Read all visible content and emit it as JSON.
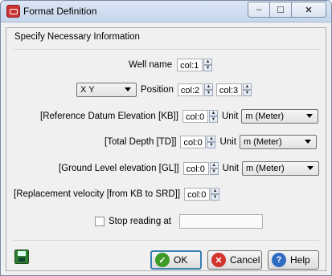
{
  "window": {
    "title": "Format Definition"
  },
  "titlebar": {
    "minimize": "–",
    "maximize": "☐",
    "close": "✕"
  },
  "header": "Specify Necessary Information",
  "well_name": {
    "label": "Well name",
    "value": "col:1"
  },
  "position": {
    "mode": "X Y",
    "label": "Position",
    "x_value": "col:2",
    "y_value": "col:3"
  },
  "ref_datum": {
    "label": "[Reference Datum Elevation [KB]]",
    "value": "col:0",
    "unit_label": "Unit",
    "unit": "m (Meter)"
  },
  "total_depth": {
    "label": "[Total Depth [TD]]",
    "value": "col:0",
    "unit_label": "Unit",
    "unit": "m (Meter)"
  },
  "ground_level": {
    "label": "[Ground Level elevation [GL]]",
    "value": "col:0",
    "unit_label": "Unit",
    "unit": "m (Meter)"
  },
  "replacement": {
    "label": "[Replacement velocity [from KB to SRD]]",
    "value": "col:0"
  },
  "stop_reading": {
    "label": "Stop reading at",
    "value": ""
  },
  "buttons": {
    "ok": "OK",
    "cancel": "Cancel",
    "help": "Help"
  }
}
